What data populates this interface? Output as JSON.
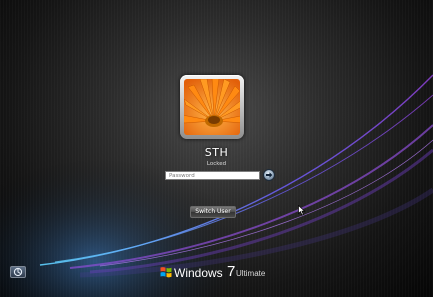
{
  "user": {
    "name": "STH",
    "status": "Locked",
    "avatar_icon": "orange-gerbera-flower-picture"
  },
  "password": {
    "placeholder": "Password",
    "value": ""
  },
  "submit": {
    "icon": "arrow-right-icon"
  },
  "switch_user": {
    "label": "Switch User"
  },
  "ease_of_access": {
    "icon": "ease-of-access-icon"
  },
  "branding": {
    "name": "Windows",
    "version": "7",
    "edition": "Ultimate"
  },
  "colors": {
    "swoosh_purple": "#7a3fd0",
    "swoosh_blue": "#3f7fe0",
    "avatar_orange": "#f07a10",
    "background": "#1e1e1e"
  }
}
